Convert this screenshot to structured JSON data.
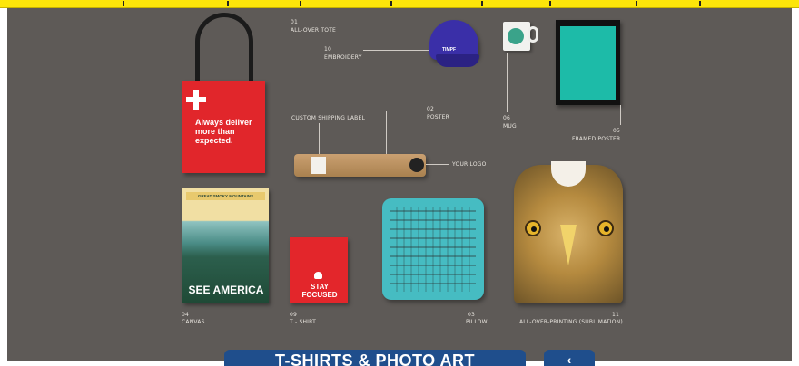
{
  "labels": {
    "tote_num": "01",
    "tote_name": "ALL-OVER TOTE",
    "embroidery_num": "10",
    "embroidery_name": "EMBROIDERY",
    "custom_label": "CUSTOM SHIPPING LABEL",
    "poster_num": "02",
    "poster_name": "POSTER",
    "mug_num": "06",
    "mug_name": "MUG",
    "framed_num": "05",
    "framed_name": "FRAMED POSTER",
    "your_logo": "YOUR LOGO",
    "canvas_num": "04",
    "canvas_name": "CANVAS",
    "tshirt_num": "09",
    "tshirt_name": "T - SHIRT",
    "pillow_num": "03",
    "pillow_name": "PILLOW",
    "aop_num": "11",
    "aop_name": "ALL-OVER-PRINTING (SUBLIMATION)"
  },
  "products": {
    "tote_text": "Always deliver more than expected.",
    "cap_text": "TIMPF",
    "canvas_banner": "GREAT SMOKY MOUNTAINS",
    "canvas_title": "SEE AMERICA",
    "tshirt_text": "STAY FOCUSED"
  },
  "buttons": {
    "main_label": "T-SHIRTS & PHOTO ART",
    "side_label": "‹"
  },
  "colors": {
    "topbar": "#fde60a",
    "background": "#5e5a57",
    "accent_red": "#e1262b",
    "button_blue": "#1f4e8c"
  }
}
